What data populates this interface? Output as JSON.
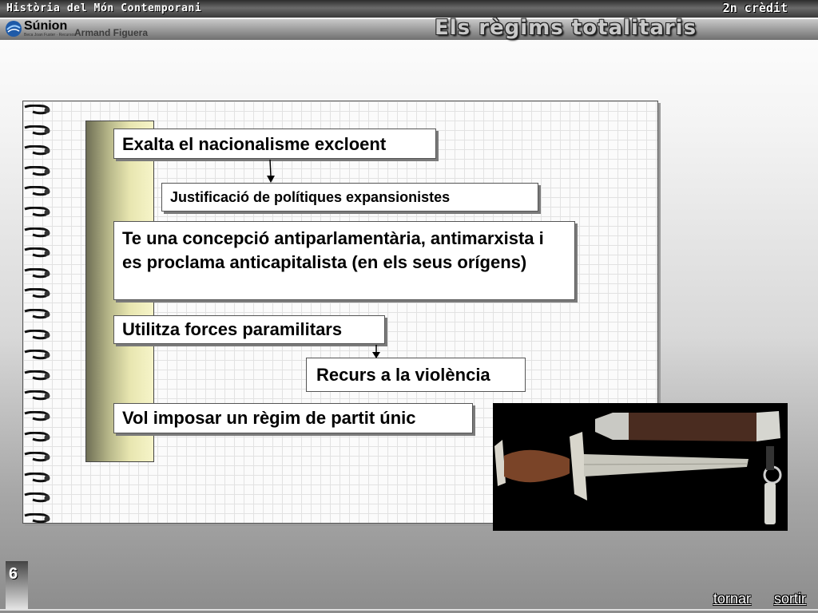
{
  "header": {
    "course_title": "Història del Món Contemporani",
    "credit": "2n crèdit",
    "logo_text": "Súnion",
    "logo_sub": "Beca Joan Fuster · Recursos",
    "author": "Armand Figuera",
    "unit_title": "Els règims totalitaris"
  },
  "notebook": {
    "items": [
      "Exalta el nacionalisme excloent",
      "Justificació de polítiques expansionistes",
      "Te una concepció antiparlamentària, antimarxista i es proclama anticapitalista (en els seus orígens)",
      "Utilitza forces paramilitars",
      "Recurs a la violència",
      "Vol imposar un règim de partit únic"
    ]
  },
  "photo": {
    "subject": "dagger-with-scabbard"
  },
  "footer": {
    "page_number": "6",
    "back_label": "tornar",
    "exit_label": "sortir"
  },
  "colors": {
    "header_dark": "#3a3a3a",
    "gold_bar": "#e8e6b0",
    "photo_bg": "#000000"
  }
}
